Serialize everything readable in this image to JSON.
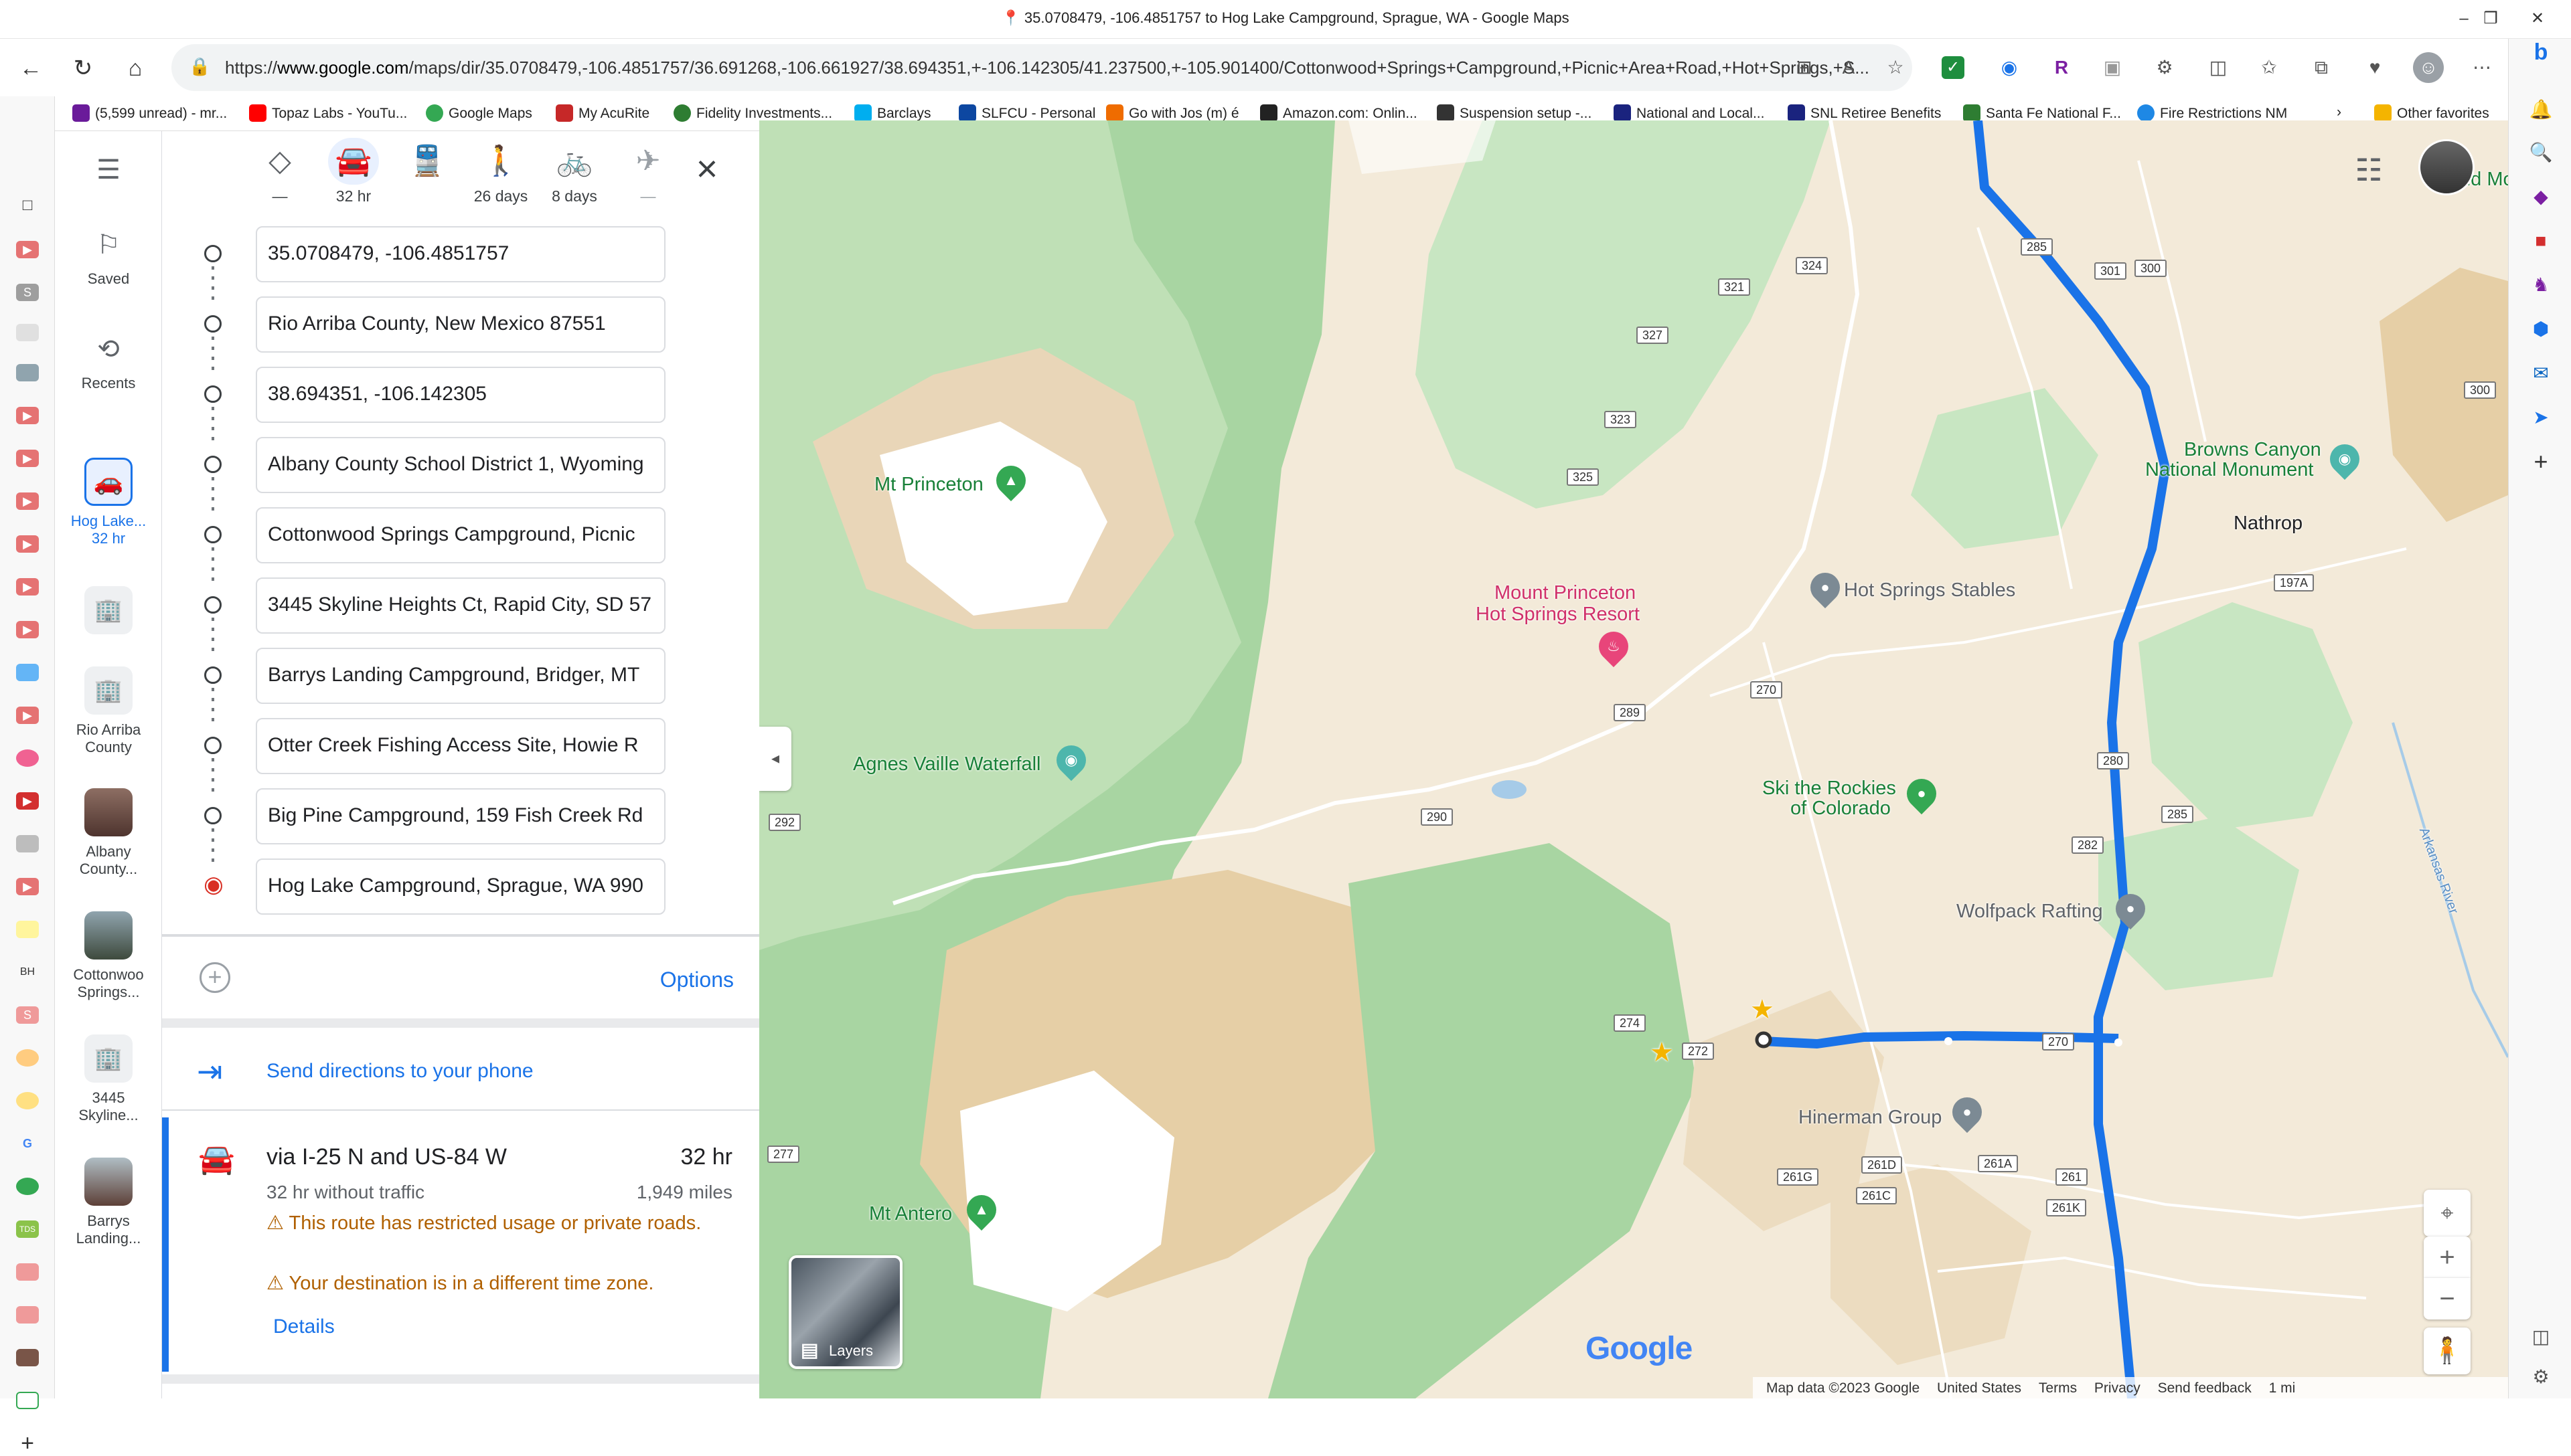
{
  "window": {
    "title": "35.0708479, -106.4851757 to Hog Lake Campground, Sprague, WA - Google Maps"
  },
  "browser": {
    "url_prefix": "https://",
    "url_domain": "www.google.com",
    "url_rest": "/maps/dir/35.0708479,-106.4851757/36.691268,-106.661927/38.694351,+-106.142305/41.237500,+-105.901400/Cottonwood+Springs+Campground,+Picnic+Area+Road,+Hot+Springs,+S...",
    "bookmarks": [
      "(5,599 unread) - mr...",
      "Topaz Labs - YouTu...",
      "Google Maps",
      "My AcuRite",
      "Fidelity Investments...",
      "Barclays",
      "SLFCU - Personal",
      "Go with Jos (m) é",
      "Amazon.com: Onlin...",
      "Suspension setup -...",
      "National and Local...",
      "SNL Retiree Benefits",
      "Santa Fe National F...",
      "Fire Restrictions NM",
      "Other favorites"
    ]
  },
  "maps_nav": {
    "saved": "Saved",
    "recents": "Recents",
    "items": [
      {
        "label_line1": "Hog Lake...",
        "label_line2": "32 hr"
      },
      {
        "label_line1": "Rio Arriba",
        "label_line2": "County"
      },
      {
        "label_line1": "Albany",
        "label_line2": "County..."
      },
      {
        "label_line1": "Cottonwoo",
        "label_line2": "Springs..."
      },
      {
        "label_line1": "3445",
        "label_line2": "Skyline..."
      },
      {
        "label_line1": "Barrys",
        "label_line2": "Landing..."
      }
    ]
  },
  "travel_modes": [
    {
      "name": "best",
      "label": "—"
    },
    {
      "name": "driving",
      "label": "32 hr"
    },
    {
      "name": "transit",
      "label": ""
    },
    {
      "name": "walking",
      "label": "26 days"
    },
    {
      "name": "cycling",
      "label": "8 days"
    },
    {
      "name": "flights",
      "label": "—"
    }
  ],
  "stops": [
    "35.0708479, -106.4851757",
    "Rio Arriba County, New Mexico 87551",
    "38.694351, -106.142305",
    "Albany County School District 1, Wyoming",
    "Cottonwood Springs Campground, Picnic",
    "3445 Skyline Heights Ct, Rapid City, SD 57",
    "Barrys Landing Campground, Bridger, MT",
    "Otter Creek Fishing Access Site, Howie R",
    "Big Pine Campground, 159 Fish Creek Rd",
    "Hog Lake Campground, Sprague, WA 990"
  ],
  "options_label": "Options",
  "send_label": "Send directions to your phone",
  "route": {
    "name": "via I-25 N and US-84 W",
    "time": "32 hr",
    "without_traffic": "32 hr without traffic",
    "distance": "1,949 miles",
    "warning1": "This route has restricted usage or private roads.",
    "warning2": "Your destination is in a different time zone.",
    "details": "Details"
  },
  "map": {
    "labels": {
      "mt_princeton": "Mt Princeton",
      "resort1": "Mount Princeton",
      "resort2": "Hot Springs Resort",
      "stables": "Hot Springs Stables",
      "nathrop": "Nathrop",
      "browns1": "Browns Canyon",
      "browns2": "National Monument",
      "agnes": "Agnes Vaille Waterfall",
      "ski1": "Ski the Rockies",
      "ski2": "of Colorado",
      "wolfpack": "Wolfpack Rafting",
      "hinerman": "Hinerman Group",
      "mt_antero": "Mt Antero",
      "river": "Arkansas River",
      "partial": "nd Mo"
    },
    "shields": [
      "324",
      "321",
      "301",
      "300",
      "327",
      "323",
      "325",
      "300",
      "197A",
      "289",
      "270",
      "280",
      "285",
      "285",
      "282",
      "290",
      "292",
      "274",
      "272",
      "270",
      "277",
      "261G",
      "261D",
      "261A",
      "261",
      "261C",
      "261K"
    ],
    "layers": "Layers",
    "logo": "Google",
    "attribution": [
      "Map data ©2023 Google",
      "United States",
      "Terms",
      "Privacy",
      "Send feedback",
      "1 mi"
    ],
    "colors": {
      "route": "#1a73e8",
      "forest": "#a8d5a2",
      "terrain": "#e9d6b8",
      "snow": "#ffffff",
      "poi_green": "#34a853",
      "poi_grey": "#7c8a94",
      "poi_pink": "#e8457a"
    }
  }
}
